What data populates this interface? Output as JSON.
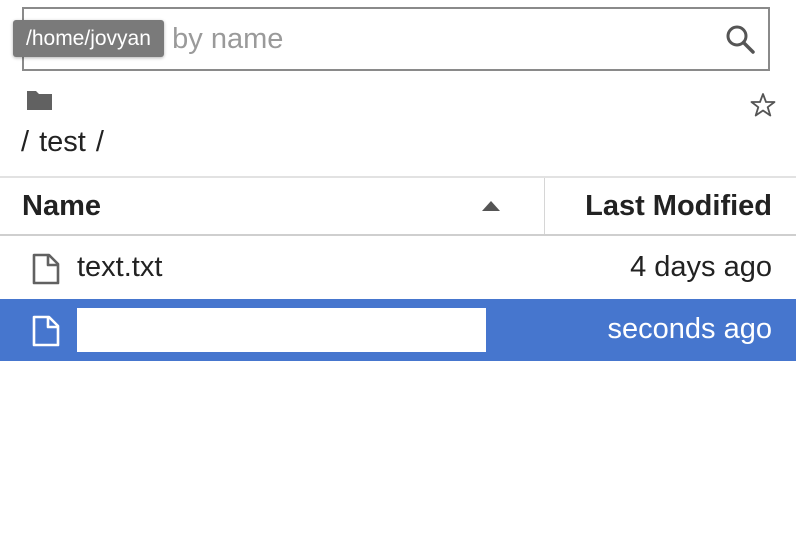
{
  "search": {
    "placeholder": "Filter files by name",
    "value": ""
  },
  "tooltip": {
    "text": "/home/jovyan"
  },
  "breadcrumb": {
    "separator_start": "/",
    "folder": "test",
    "separator_end": "/"
  },
  "header": {
    "name_label": "Name",
    "modified_label": "Last Modified",
    "sort": "ascending"
  },
  "files": [
    {
      "name": "text.txt",
      "modified": "4 days ago",
      "selected": false,
      "icon": "file-icon"
    },
    {
      "name": "",
      "modified": "seconds ago",
      "selected": true,
      "renaming": true,
      "icon": "file-icon"
    }
  ],
  "colors": {
    "selection": "#4676ce",
    "icon_gray": "#616161",
    "tooltip_bg": "#7a7a7a"
  }
}
